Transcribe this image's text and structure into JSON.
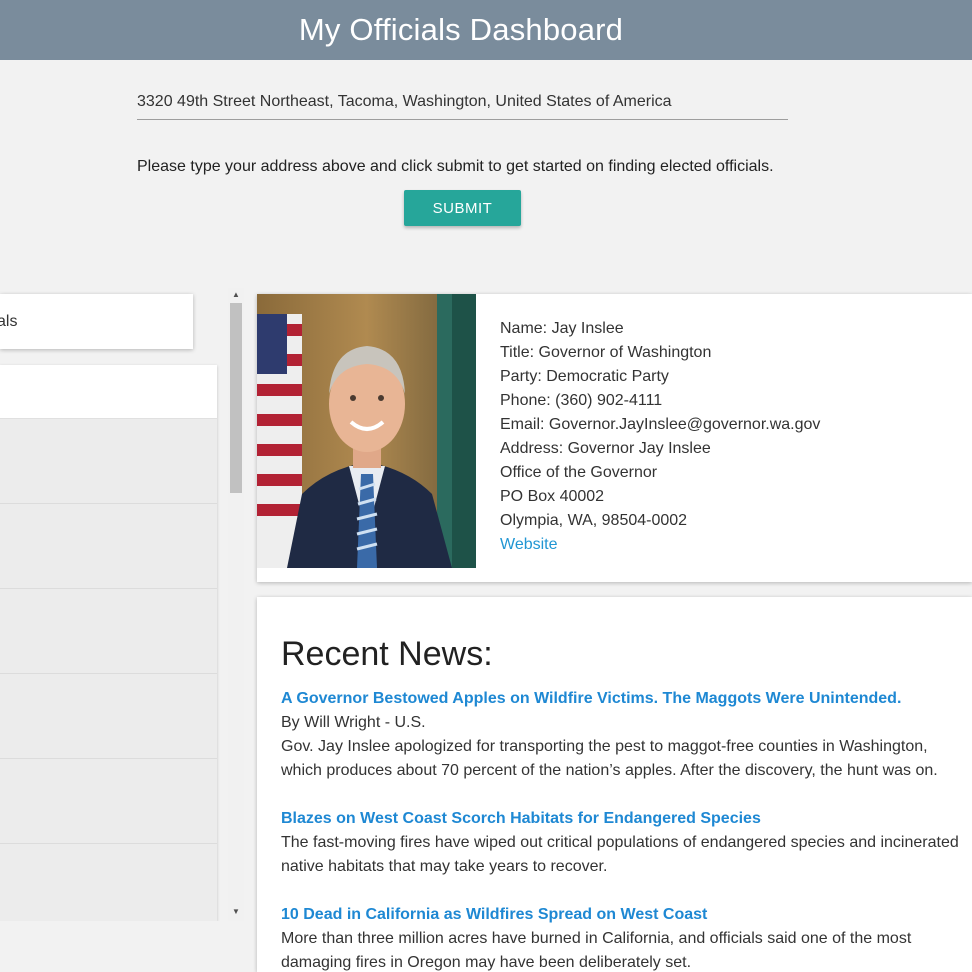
{
  "header": {
    "title": "My Officials Dashboard"
  },
  "search": {
    "address_value": "3320 49th Street Northeast, Tacoma, Washington, United States of America",
    "instructions": "Please type your address above and click submit to get started on finding elected officials.",
    "submit_label": "SUBMIT"
  },
  "sidebar": {
    "top_card_label": "als"
  },
  "official": {
    "name": "Name: Jay Inslee",
    "title": "Title: Governor of Washington",
    "party": "Party: Democratic Party",
    "phone": "Phone: (360) 902-4111",
    "email": "Email: Governor.JayInslee@governor.wa.gov",
    "address_line1": "Address: Governor Jay Inslee",
    "address_line2": "Office of the Governor",
    "address_line3": "PO Box 40002",
    "address_line4": "Olympia, WA, 98504-0002",
    "website_label": "Website"
  },
  "news": {
    "heading": "Recent News:",
    "items": [
      {
        "headline": "A Governor Bestowed Apples on Wildfire Victims. The Maggots Were Unintended.",
        "byline": "By Will Wright - U.S.",
        "summary": "Gov. Jay Inslee apologized for transporting the pest to maggot-free counties in Washington, which produces about 70 percent of the nation’s apples. After the discovery, the hunt was on."
      },
      {
        "headline": "Blazes on West Coast Scorch Habitats for Endangered Species",
        "byline": "",
        "summary": "The fast-moving fires have wiped out critical populations of endangered species and incinerated native habitats that may take years to recover."
      },
      {
        "headline": "10 Dead in California as Wildfires Spread on West Coast",
        "byline": "",
        "summary": "More than three million acres have burned in California, and officials said one of the most damaging fires in Oregon may have been deliberately set."
      }
    ]
  },
  "colors": {
    "header_bg": "#7a8c9c",
    "accent": "#26a69a",
    "link": "#2196d3"
  }
}
